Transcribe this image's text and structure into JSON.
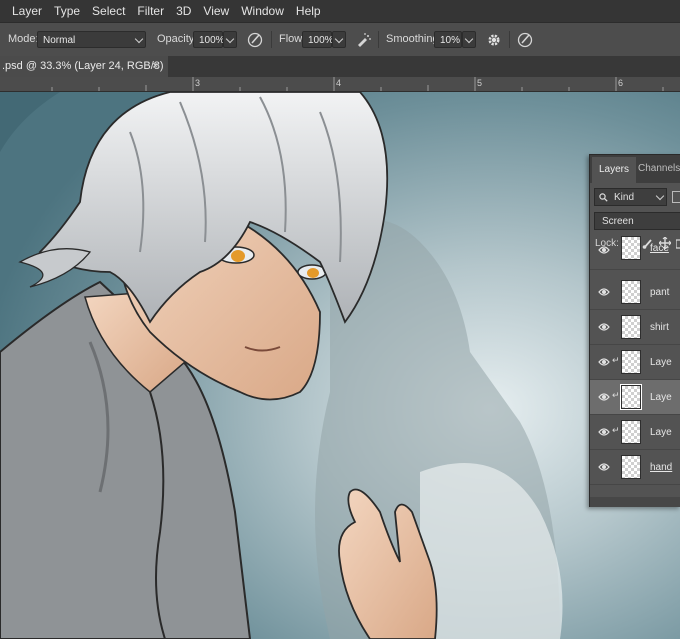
{
  "menubar": {
    "items": [
      "Layer",
      "Type",
      "Select",
      "Filter",
      "3D",
      "View",
      "Window",
      "Help"
    ]
  },
  "options": {
    "mode_label": "Mode:",
    "mode_value": "Normal",
    "opacity_label": "Opacity:",
    "opacity_value": "100%",
    "flow_label": "Flow:",
    "flow_value": "100%",
    "smoothing_label": "Smoothing:",
    "smoothing_value": "10%"
  },
  "document_tab": {
    "title": ".psd @ 33.3% (Layer 24, RGB/8) *",
    "close": "×"
  },
  "ruler": {
    "ticks": [
      "3",
      "4",
      "5",
      "6"
    ]
  },
  "layers_panel": {
    "tabs": [
      "Layers",
      "Channels"
    ],
    "filter_value": "Kind",
    "blend_mode": "Screen",
    "lock_label": "Lock:",
    "layers": [
      {
        "name": "face",
        "selected": false,
        "clipped": false
      },
      {
        "name": "pant",
        "selected": false,
        "clipped": false
      },
      {
        "name": "shirt",
        "selected": false,
        "clipped": false
      },
      {
        "name": "Laye",
        "selected": false,
        "clipped": true
      },
      {
        "name": "Laye",
        "selected": true,
        "clipped": true
      },
      {
        "name": "Laye",
        "selected": false,
        "clipped": true
      },
      {
        "name": "hand",
        "selected": false,
        "clipped": false
      }
    ]
  },
  "colors": {
    "canvas_bg": "#5f8590",
    "hair": "#d9dbdd",
    "skin": "#e8c2a6",
    "shirt": "#8e9194",
    "eyes": "#e49a2a"
  }
}
